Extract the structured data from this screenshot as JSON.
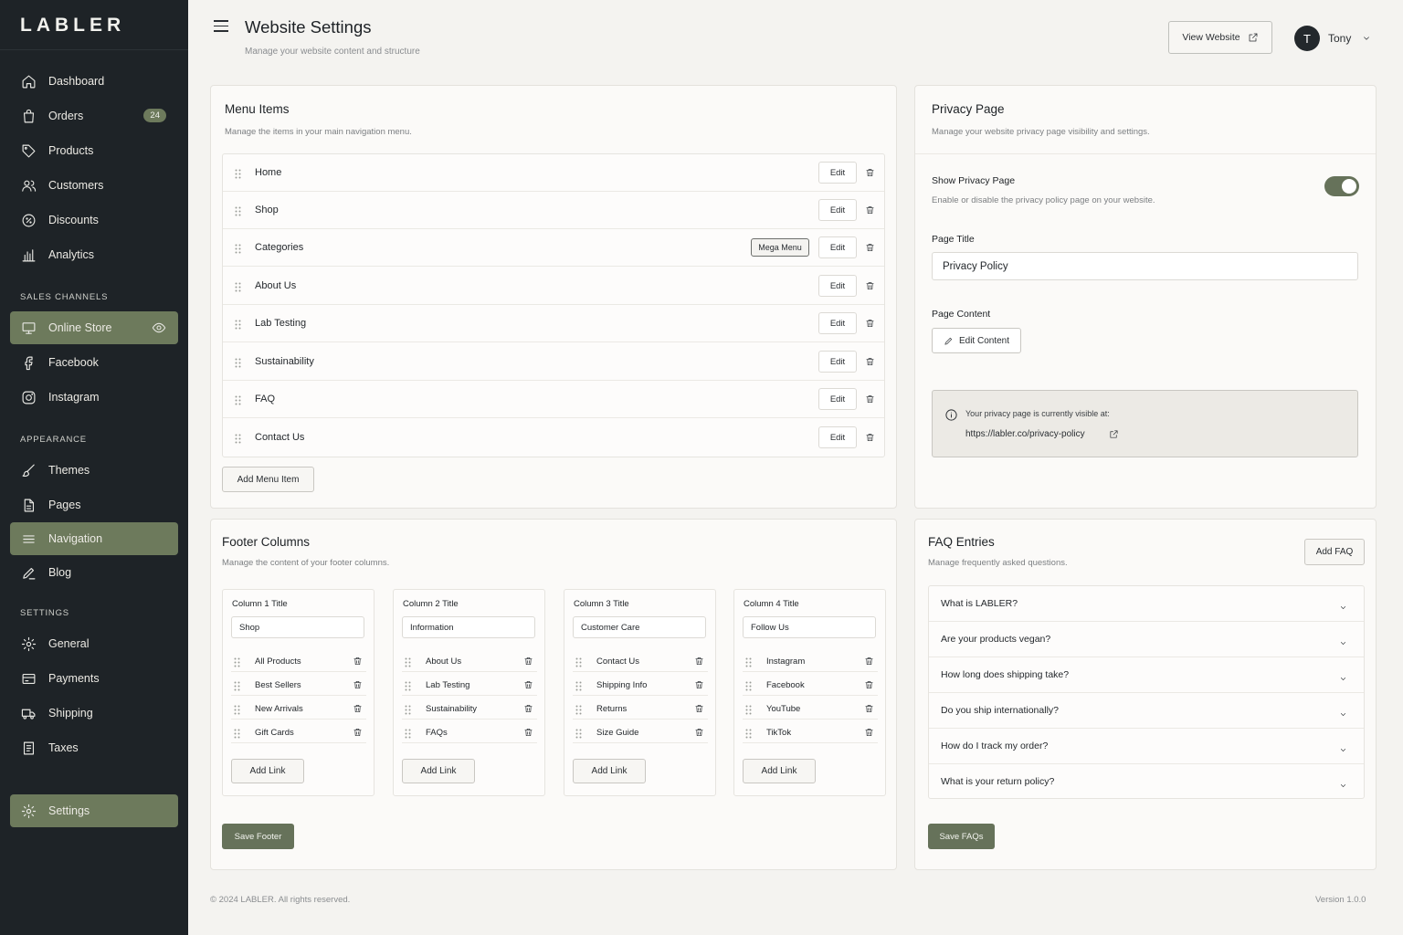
{
  "brand": "LABLER",
  "sidebar": {
    "items": [
      {
        "label": "Dashboard",
        "icon": "home-icon"
      },
      {
        "label": "Orders",
        "icon": "shopping-bag-icon",
        "badge": "24"
      },
      {
        "label": "Products",
        "icon": "tag-icon"
      },
      {
        "label": "Customers",
        "icon": "users-icon"
      },
      {
        "label": "Discounts",
        "icon": "percent-icon"
      },
      {
        "label": "Analytics",
        "icon": "bar-chart-icon"
      }
    ],
    "sales_channels_label": "SALES CHANNELS",
    "sales_channels": [
      {
        "label": "Online Store",
        "icon": "monitor-icon",
        "active": true
      },
      {
        "label": "Facebook",
        "icon": "facebook-icon"
      },
      {
        "label": "Instagram",
        "icon": "instagram-icon"
      }
    ],
    "appearance_label": "APPEARANCE",
    "appearance": [
      {
        "label": "Themes",
        "icon": "brush-icon"
      },
      {
        "label": "Pages",
        "icon": "file-icon"
      },
      {
        "label": "Navigation",
        "icon": "menu-icon",
        "active": true
      },
      {
        "label": "Blog",
        "icon": "pen-icon"
      }
    ],
    "settings_label": "SETTINGS",
    "settings": [
      {
        "label": "General",
        "icon": "gear-icon"
      },
      {
        "label": "Payments",
        "icon": "credit-card-icon"
      },
      {
        "label": "Shipping",
        "icon": "truck-icon"
      },
      {
        "label": "Taxes",
        "icon": "receipt-icon"
      }
    ],
    "bottom": {
      "label": "Settings",
      "icon": "gear-icon",
      "active": true
    }
  },
  "header": {
    "title": "Website Settings",
    "subtitle": "Manage your website content and structure",
    "view_website": "View Website",
    "user_initial": "T",
    "user_name": "Tony"
  },
  "menu_items": {
    "title": "Menu Items",
    "subtitle": "Manage the items in your main navigation menu.",
    "edit_label": "Edit",
    "items": [
      {
        "label": "Home"
      },
      {
        "label": "Shop"
      },
      {
        "label": "Categories",
        "tag": "Mega Menu"
      },
      {
        "label": "About Us"
      },
      {
        "label": "Lab Testing"
      },
      {
        "label": "Sustainability"
      },
      {
        "label": "FAQ"
      },
      {
        "label": "Contact Us"
      }
    ],
    "add_label": "Add Menu Item"
  },
  "privacy": {
    "title": "Privacy Page",
    "subtitle": "Manage your website privacy page visibility and settings.",
    "show_label": "Show Privacy Page",
    "show_help": "Enable or disable the privacy policy page on your website.",
    "show_enabled": true,
    "page_title_label": "Page Title",
    "page_title_value": "Privacy Policy",
    "page_content_label": "Page Content",
    "edit_content": "Edit Content",
    "info_text": "Your privacy page is currently visible at:",
    "info_url": "https://labler.co/privacy-policy"
  },
  "footer": {
    "title": "Footer Columns",
    "subtitle": "Manage the content of your footer columns.",
    "columns": [
      {
        "title_label": "Column 1 Title",
        "title": "Shop",
        "links": [
          "All Products",
          "Best Sellers",
          "New Arrivals",
          "Gift Cards"
        ]
      },
      {
        "title_label": "Column 2 Title",
        "title": "Information",
        "links": [
          "About Us",
          "Lab Testing",
          "Sustainability",
          "FAQs"
        ]
      },
      {
        "title_label": "Column 3 Title",
        "title": "Customer Care",
        "links": [
          "Contact Us",
          "Shipping Info",
          "Returns",
          "Size Guide"
        ]
      },
      {
        "title_label": "Column 4 Title",
        "title": "Follow Us",
        "links": [
          "Instagram",
          "Facebook",
          "YouTube",
          "TikTok"
        ]
      }
    ],
    "add_link": "Add Link",
    "save": "Save Footer"
  },
  "faq": {
    "title": "FAQ Entries",
    "subtitle": "Manage frequently asked questions.",
    "add": "Add FAQ",
    "entries": [
      "What is LABLER?",
      "Are your products vegan?",
      "How long does shipping take?",
      "Do you ship internationally?",
      "How do I track my order?",
      "What is your return policy?"
    ],
    "save": "Save FAQs"
  },
  "footer_bar": {
    "copyright": "© 2024 LABLER. All rights reserved.",
    "version": "Version 1.0.0"
  },
  "colors": {
    "sidebar_bg": "#1e2327",
    "accent": "#6d7a5c",
    "primary_button": "#66725a",
    "page_bg": "#f4f3f0"
  }
}
